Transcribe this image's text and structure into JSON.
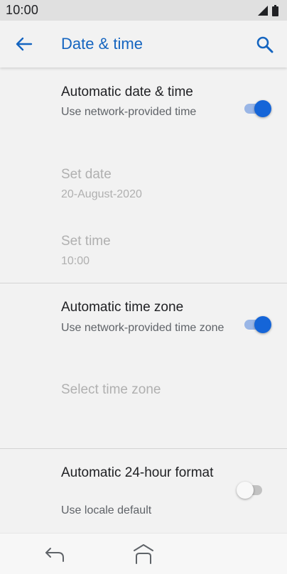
{
  "status_bar": {
    "time": "10:00"
  },
  "app_bar": {
    "title": "Date & time"
  },
  "preferences": {
    "auto_datetime": {
      "title": "Automatic date & time",
      "summary": "Use network-provided time",
      "checked": true
    },
    "set_date": {
      "title": "Set date",
      "summary": "20-August-2020"
    },
    "set_time": {
      "title": "Set time",
      "summary": "10:00"
    },
    "auto_timezone": {
      "title": "Automatic time zone",
      "summary": "Use network-provided time zone",
      "checked": true
    },
    "select_timezone": {
      "title": "Select time zone"
    },
    "auto_24h": {
      "title": "Automatic 24-hour format",
      "summary": "Use locale default",
      "checked": false
    }
  },
  "icons": {
    "status": [
      "signal-icon",
      "battery-icon"
    ],
    "app_bar": [
      "back-arrow-icon",
      "search-icon"
    ],
    "nav": [
      "nav-back-icon",
      "nav-home-icon"
    ]
  },
  "colors": {
    "accent": "#1565d8",
    "title_blue": "#1565c0",
    "switch_track_on": "#9ab6e6",
    "switch_off": "#c2c2c2",
    "background": "#f2f2f2",
    "status_bar": "#e0e0e0"
  }
}
